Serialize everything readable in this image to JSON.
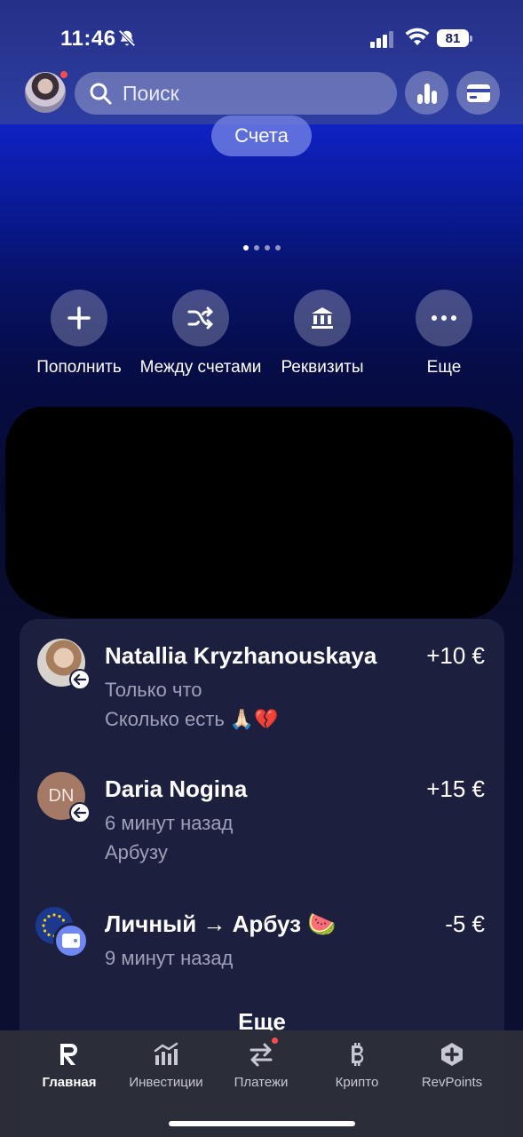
{
  "status_bar": {
    "time": "11:46",
    "battery": "81"
  },
  "header": {
    "search_placeholder": "Поиск",
    "accounts_label": "Счета",
    "pager": {
      "count": 4,
      "active": 0
    }
  },
  "actions": [
    {
      "label": "Пополнить",
      "icon": "plus-icon"
    },
    {
      "label": "Между счетами",
      "icon": "shuffle-icon"
    },
    {
      "label": "Реквизиты",
      "icon": "bank-icon"
    },
    {
      "label": "Еще",
      "icon": "more-icon"
    }
  ],
  "transactions": [
    {
      "name": "Natallia Kryzhanouskaya",
      "amount": "+10 €",
      "time": "Только что",
      "note": "Сколько есть 🙏🏻💔",
      "avatar": "photo"
    },
    {
      "name": "Daria Nogina",
      "amount": "+15 €",
      "time": "6 минут назад",
      "note": "Арбузу",
      "avatar_initials": "DN"
    },
    {
      "name": "Личный → Арбуз 🍉",
      "amount": "-5 €",
      "time": "9 минут назад",
      "avatar": "eu-wallet"
    }
  ],
  "transactions_more_label": "Еще",
  "tabbar": [
    {
      "label": "Главная",
      "icon": "revolut-r-icon",
      "active": true
    },
    {
      "label": "Инвестиции",
      "icon": "chart-icon"
    },
    {
      "label": "Платежи",
      "icon": "transfer-arrows-icon",
      "badge": true
    },
    {
      "label": "Крипто",
      "icon": "bitcoin-icon"
    },
    {
      "label": "RevPoints",
      "icon": "revpoints-icon"
    }
  ],
  "colors": {
    "accent_blue": "#1226d6",
    "notification_red": "#ff4d4f",
    "card_bg": "#1c1f3d"
  }
}
